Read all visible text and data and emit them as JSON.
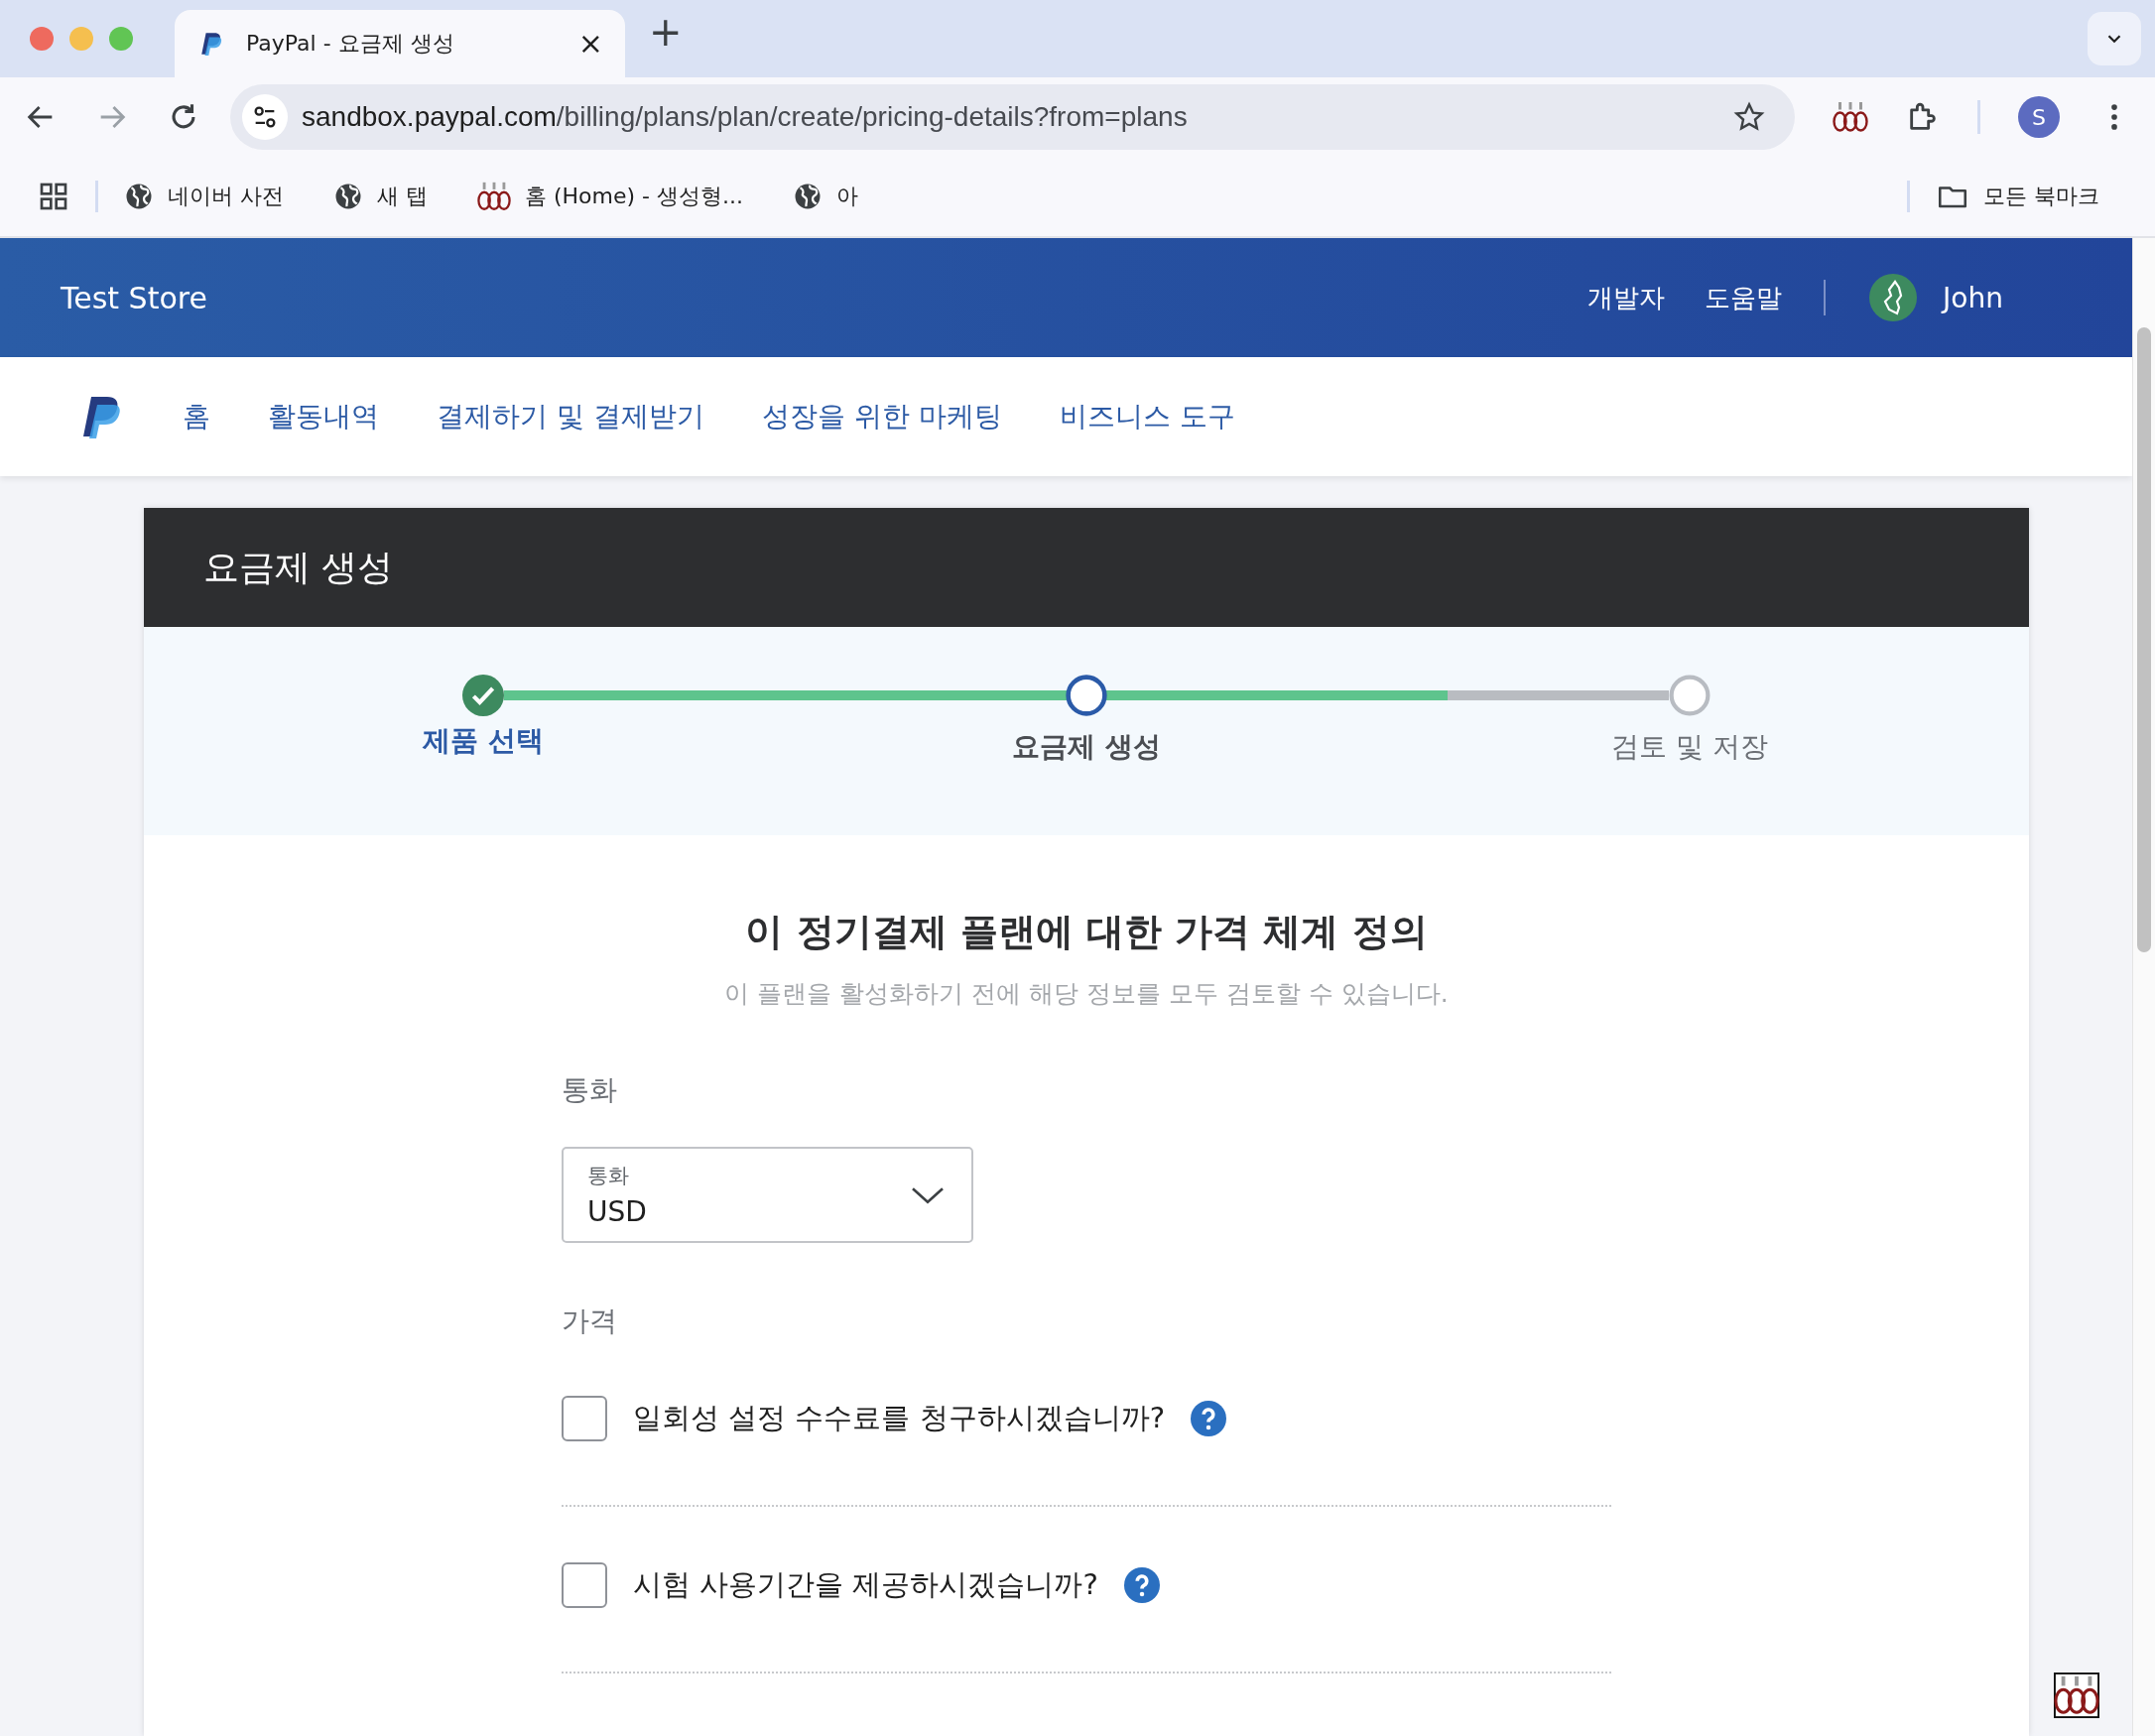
{
  "browser": {
    "tabs": [
      {
        "title": "PayPal - 요금제 생성",
        "close": "×",
        "selected": true
      }
    ],
    "new_tab": "+",
    "url": {
      "host": "sandbox.paypal.com",
      "path": "/billing/plans/plan/create/pricing-details?from=plans"
    },
    "profile_initial": "S",
    "bookmarks": [
      {
        "label": "네이버 사전",
        "kind": "globe"
      },
      {
        "label": "새 탭",
        "kind": "globe"
      },
      {
        "label": "홈 (Home) - 생성형...",
        "kind": "extension"
      },
      {
        "label": "아",
        "kind": "globe"
      }
    ],
    "all_bookmarks": "모든 북마크"
  },
  "header": {
    "store": "Test Store",
    "links": [
      "개발자",
      "도움말"
    ],
    "user": "John"
  },
  "nav": [
    {
      "label": "홈"
    },
    {
      "label": "활동내역"
    },
    {
      "label": "결제하기 및 결제받기"
    },
    {
      "label": "성장을 위한 마케팅"
    },
    {
      "label": "비즈니스 도구"
    }
  ],
  "card": {
    "title": "요금제 생성",
    "stepper": {
      "level": 0.81,
      "steps": [
        {
          "label": "제품 선택",
          "kind": "complete"
        },
        {
          "label": "요금제 생성",
          "kind": "current"
        },
        {
          "label": "검토 및 저장",
          "kind": "upcoming"
        }
      ]
    },
    "heading": "이 정기결제 플랜에 대한 가격 체계 정의",
    "subtitle": "이 플랜을 활성화하기 전에 해당 정보를 모두 검토할 수 있습니다.",
    "currency": {
      "section": "통화",
      "field_label": "통화",
      "value": "USD"
    },
    "price": {
      "section": "가격",
      "options": [
        {
          "label": "일회성 설정 수수료를 청구하시겠습니까?",
          "checked": false
        },
        {
          "label": "시험 사용기간을 제공하시겠습니까?",
          "checked": false
        }
      ]
    }
  }
}
